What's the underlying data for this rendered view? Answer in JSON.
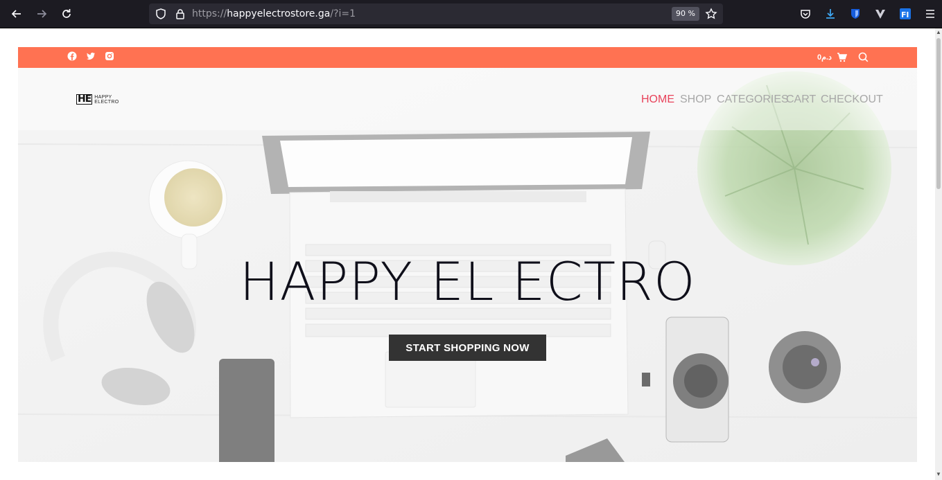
{
  "browser": {
    "url_prefix": "https://",
    "url_domain": "happyelectrostore.ga",
    "url_path": "/?i=1",
    "zoom": "90 %"
  },
  "topbar": {
    "cart_amount": "0د.م",
    "color": "#ff7252"
  },
  "logo": {
    "mark": "HE",
    "line1": "HAPPY",
    "line2": "ELECTRO"
  },
  "nav": {
    "items": [
      "HOME",
      "SHOP",
      "CATEGORIES",
      "CART",
      "CHECKOUT"
    ],
    "active_color": "#e8425a"
  },
  "hero": {
    "title": "HAPPY EL ECTRO",
    "cta": "START SHOPPING NOW"
  }
}
